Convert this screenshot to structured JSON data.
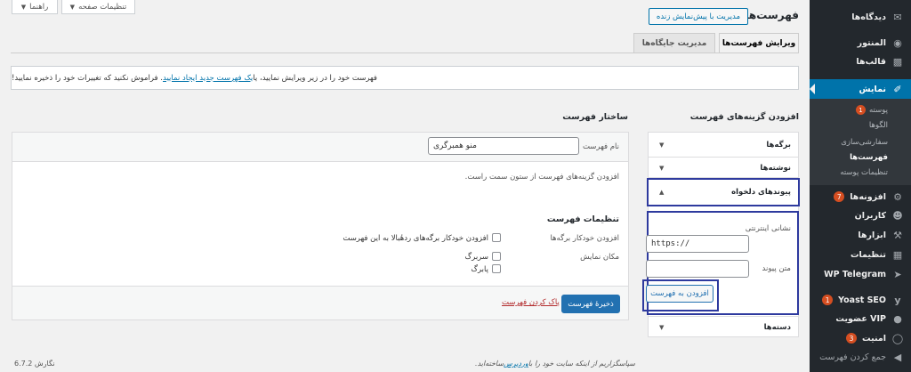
{
  "top_bar": {
    "screen_options_label": "تنظیمات صفحه",
    "help_label": "راهنما"
  },
  "page": {
    "title": "فهرست‌ها",
    "live_preview_button": "مدیریت با پیش‌نمایش زنده"
  },
  "tabs": [
    {
      "label": "ویرایش فهرست‌ها",
      "active": true
    },
    {
      "label": "مدیریت جایگاه‌ها",
      "active": false
    }
  ],
  "notice": {
    "text_before": "فهرست خود را در زیر ویرایش نمایید، یا ",
    "link_text": "یک فهرست جدید ایجاد نمایید",
    "text_after": ". فراموش نکنید که تغییرات خود را ذخیره نمایید!"
  },
  "add_items": {
    "heading": "افزودن گزینه‌های فهرست",
    "sections": [
      {
        "title": "برگه‌ها",
        "expanded": false
      },
      {
        "title": "نوشته‌ها",
        "expanded": false
      },
      {
        "title": "پیوندهای دلخواه",
        "expanded": true
      },
      {
        "title": "دسته‌ها",
        "expanded": false
      }
    ],
    "custom_links": {
      "url_label": "نشانی اینترنتی",
      "url_value": "https://",
      "link_text_label": "متن پیوند",
      "link_text_value": "",
      "add_button": "افزودن به فهرست"
    }
  },
  "structure": {
    "heading": "ساختار فهرست",
    "menu_name_label": "نام فهرست",
    "menu_name_value": "منو همبرگری",
    "instruction": "افزودن گزینه‌های فهرست از ستون سمت راست.",
    "settings_heading": "تنظیمات فهرست",
    "auto_add_label": "افزودن خودکار برگه‌ها",
    "auto_add_option": "افزودن خودکار برگه‌های ردهٔبالا به این فهرست",
    "display_location_label": "مکان نمایش",
    "locations": [
      {
        "label": "سربرگ",
        "checked": false
      },
      {
        "label": "پابرگ",
        "checked": false
      }
    ],
    "save_button": "ذخیرهٔ فهرست",
    "delete_link": "پاک کردن فهرست"
  },
  "footer": {
    "thanks_text": "سپاسگزاریم از اینکه سایت خود را با ",
    "wordpress_link": "وردپرس",
    "thanks_after": " ساخته‌اید.",
    "version": "نگارش 6.7.2"
  },
  "sidebar": {
    "items": [
      {
        "label": "دیدگاه‌ها",
        "icon": "comment-icon"
      },
      {
        "label": "المنتور",
        "icon": "elementor-icon"
      },
      {
        "label": "قالب‌ها",
        "icon": "templates-icon"
      },
      {
        "label": "نمایش",
        "icon": "appearance-icon",
        "active": true
      },
      {
        "label": "افزونه‌ها",
        "icon": "plugins-icon",
        "badge": "7"
      },
      {
        "label": "کاربران",
        "icon": "users-icon"
      },
      {
        "label": "ابزارها",
        "icon": "tools-icon"
      },
      {
        "label": "تنظیمات",
        "icon": "settings-icon"
      },
      {
        "label": "WP Telegram",
        "icon": "telegram-icon"
      },
      {
        "label": "Yoast SEO",
        "icon": "yoast-icon",
        "badge": "1"
      },
      {
        "label": "عضویت VIP",
        "icon": "vip-icon"
      },
      {
        "label": "امنیت",
        "icon": "security-icon",
        "badge": "3"
      },
      {
        "label": "جمع کردن فهرست",
        "icon": "collapse-icon"
      }
    ],
    "submenu": [
      {
        "label": "پوسته",
        "badge": "1"
      },
      {
        "label": "الگوها"
      },
      {
        "label": "سفارشی‌سازی"
      },
      {
        "label": "فهرست‌ها",
        "current": true
      },
      {
        "label": "تنظیمات پوسته"
      }
    ]
  },
  "colors": {
    "sidebar_bg": "#23282d",
    "active_blue": "#0073aa",
    "primary_button": "#2271b1",
    "highlight_box": "#2e3a9e",
    "badge_red": "#d54e21"
  }
}
